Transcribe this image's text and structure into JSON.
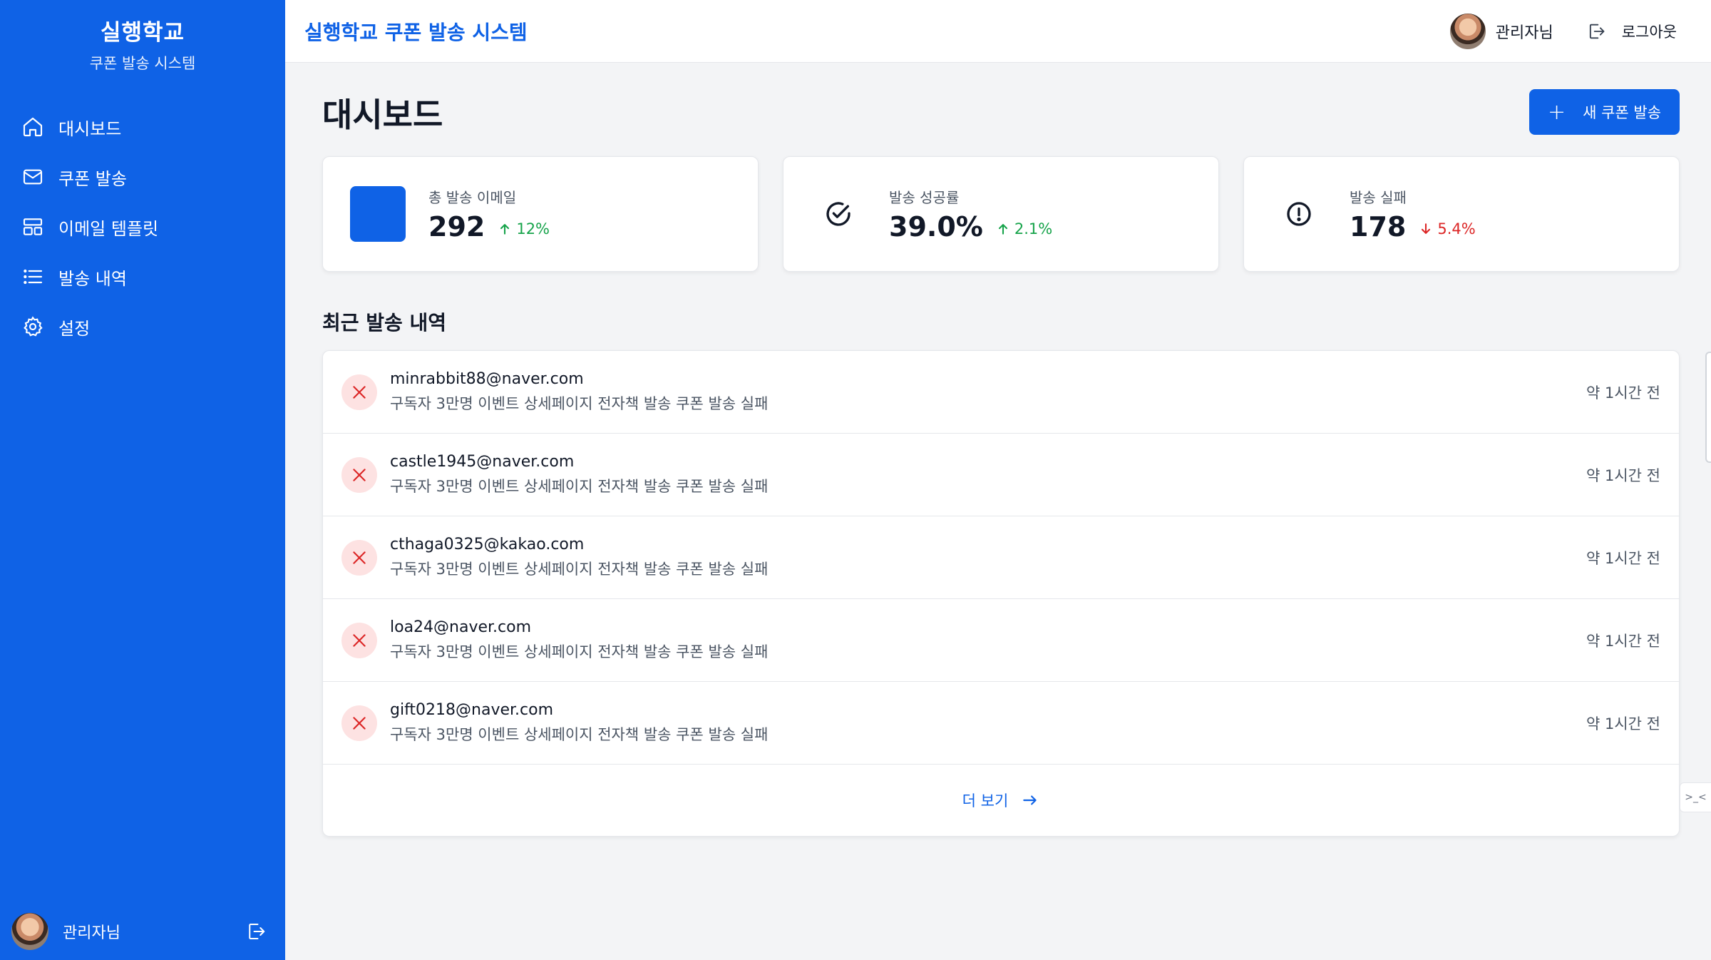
{
  "sidebar": {
    "brand_title": "실행학교",
    "brand_subtitle": "쿠폰 발송 시스템",
    "items": [
      {
        "label": "대시보드",
        "icon": "home-icon"
      },
      {
        "label": "쿠폰 발송",
        "icon": "mail-icon"
      },
      {
        "label": "이메일 템플릿",
        "icon": "template-icon"
      },
      {
        "label": "발송 내역",
        "icon": "list-icon"
      },
      {
        "label": "설정",
        "icon": "gear-icon"
      }
    ],
    "user_name": "관리자님"
  },
  "header": {
    "title": "실행학교 쿠폰 발송 시스템",
    "user_name": "관리자님",
    "logout_label": "로그아웃"
  },
  "main": {
    "page_title": "대시보드",
    "new_button_label": "새 쿠폰 발송",
    "stats": [
      {
        "label": "총 발송 이메일",
        "value": "292",
        "delta": "12%",
        "trend": "up"
      },
      {
        "label": "발송 성공률",
        "value": "39.0%",
        "delta": "2.1%",
        "trend": "up"
      },
      {
        "label": "발송 실패",
        "value": "178",
        "delta": "5.4%",
        "trend": "down"
      }
    ],
    "recent_title": "최근 발송 내역",
    "recent": [
      {
        "email": "minrabbit88@naver.com",
        "desc": "구독자 3만명 이벤트 상세페이지 전자책 발송 쿠폰 발송 실패",
        "time": "약 1시간 전"
      },
      {
        "email": "castle1945@naver.com",
        "desc": "구독자 3만명 이벤트 상세페이지 전자책 발송 쿠폰 발송 실패",
        "time": "약 1시간 전"
      },
      {
        "email": "cthaga0325@kakao.com",
        "desc": "구독자 3만명 이벤트 상세페이지 전자책 발송 쿠폰 발송 실패",
        "time": "약 1시간 전"
      },
      {
        "email": "loa24@naver.com",
        "desc": "구독자 3만명 이벤트 상세페이지 전자책 발송 쿠폰 발송 실패",
        "time": "약 1시간 전"
      },
      {
        "email": "gift0218@naver.com",
        "desc": "구독자 3만명 이벤트 상세페이지 전자책 발송 쿠폰 발송 실패",
        "time": "약 1시간 전"
      }
    ],
    "more_label": "더 보기"
  },
  "colors": {
    "brand": "#0f62e6",
    "success": "#16a34a",
    "danger": "#dc2626",
    "fail_bg": "#fde2e2"
  }
}
